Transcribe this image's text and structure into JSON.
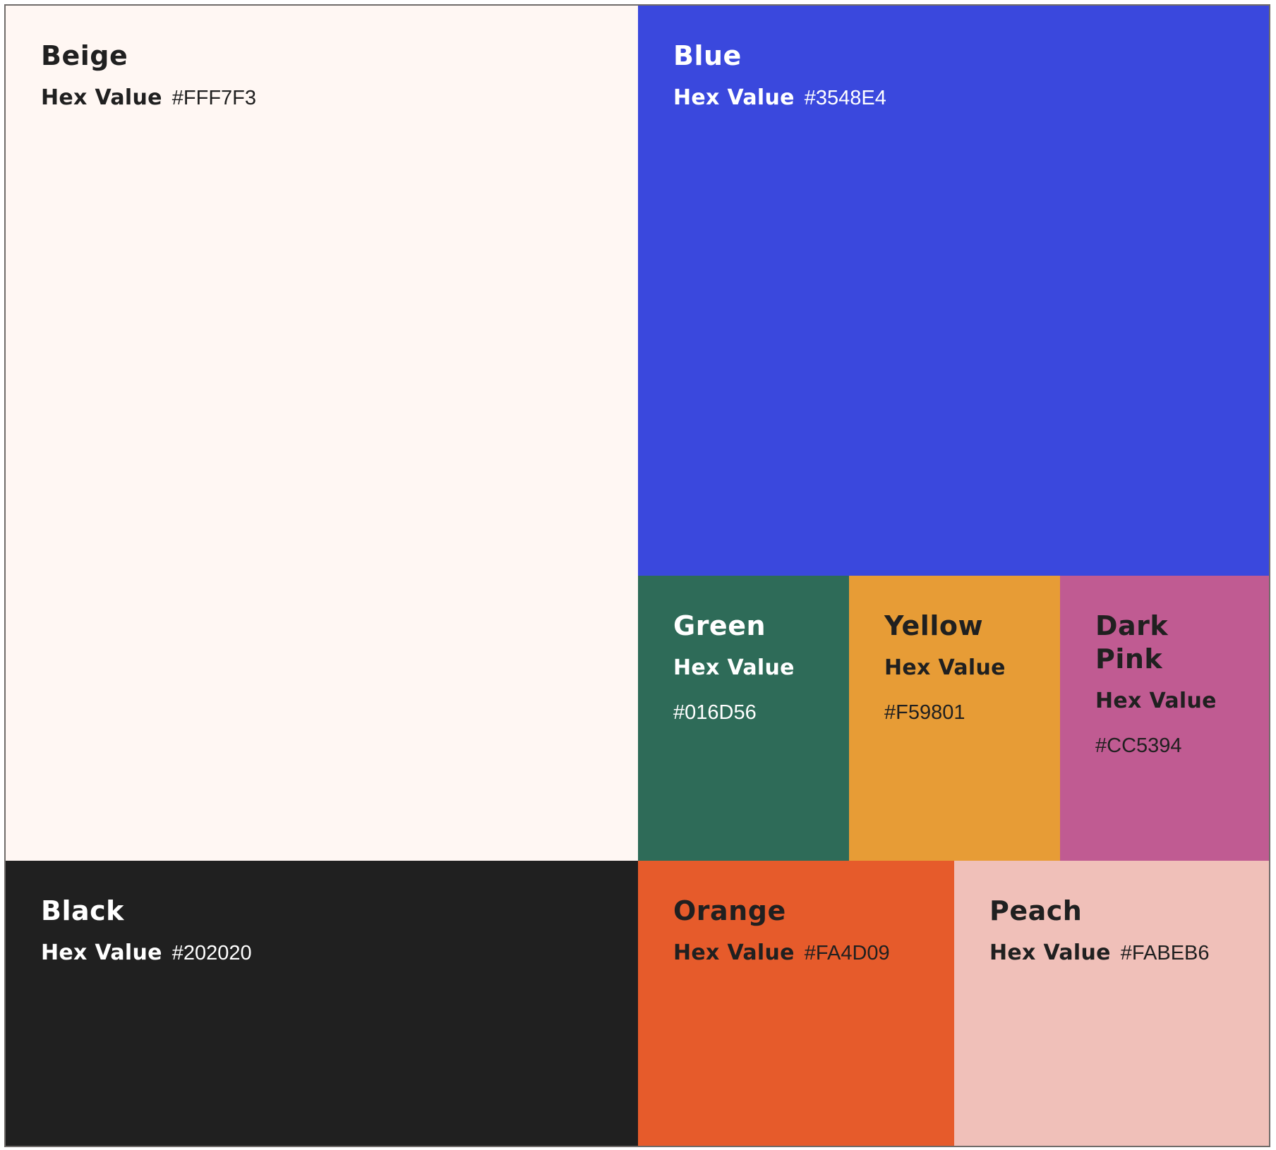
{
  "hex_label": "Hex Value",
  "swatches": {
    "beige": {
      "name": "Beige",
      "hex": "#FFF7F3",
      "color": "#FFF7F3",
      "text_color": "#202020"
    },
    "blue": {
      "name": "Blue",
      "hex": "#3548E4",
      "color": "#3A48DD",
      "text_color": "#FFFFFF"
    },
    "green": {
      "name": "Green",
      "hex": "#016D56",
      "color": "#2E6B58",
      "text_color": "#FFFFFF"
    },
    "yellow": {
      "name": "Yellow",
      "hex": "#F59801",
      "color": "#E79C36",
      "text_color": "#202020"
    },
    "dark_pink": {
      "name": "Dark\nPink",
      "hex": "#CC5394",
      "color": "#C05B92",
      "text_color": "#202020"
    },
    "black": {
      "name": "Black",
      "hex": "#202020",
      "color": "#202020",
      "text_color": "#FFFFFF"
    },
    "orange": {
      "name": "Orange",
      "hex": "#FA4D09",
      "color": "#E65B2B",
      "text_color": "#202020"
    },
    "peach": {
      "name": "Peach",
      "hex": "#FABEB6",
      "color": "#F0C0B9",
      "text_color": "#202020"
    }
  }
}
